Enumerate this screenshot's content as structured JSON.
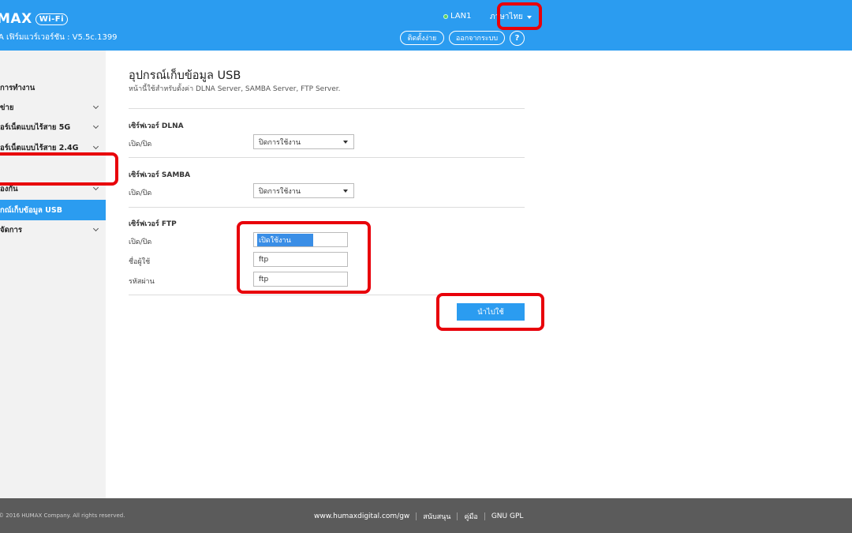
{
  "header": {
    "logo_text": "MAX",
    "logo_badge": "Wi-Fi",
    "firmware": "A เฟิร์มแวร์เวอร์ชัน : V5.5c.1399",
    "lan_label": "LAN1",
    "language": "ภาษาไทย",
    "setup_button": "ติดตั้งง่าย",
    "logout_button": "ออกจากระบบ",
    "help_label": "?"
  },
  "sidebar": {
    "items": [
      {
        "label": "การทำงาน",
        "chevron": false,
        "active": false
      },
      {
        "label": "ข่าย",
        "chevron": true,
        "active": false
      },
      {
        "label": "อร์เน็ตแบบไร้สาย 5G",
        "chevron": true,
        "active": false
      },
      {
        "label": "อร์เน็ตแบบไร้สาย 2.4G",
        "chevron": true,
        "active": false
      },
      {
        "label": "",
        "chevron": false,
        "active": false
      },
      {
        "label": "องกัน",
        "chevron": true,
        "active": false
      },
      {
        "label": "กณ์เก็บข้อมูล USB",
        "chevron": false,
        "active": true
      },
      {
        "label": "จัดการ",
        "chevron": true,
        "active": false
      }
    ]
  },
  "main": {
    "title": "อุปกรณ์เก็บข้อมูล USB",
    "description": "หน้านี้ใช้สำหรับตั้งค่า DLNA Server, SAMBA Server, FTP Server.",
    "dlna": {
      "title": "เซิร์ฟเวอร์ DLNA",
      "onoff_label": "เปิด/ปิด",
      "onoff_value": "ปิดการใช้งาน"
    },
    "samba": {
      "title": "เซิร์ฟเวอร์ SAMBA",
      "onoff_label": "เปิด/ปิด",
      "onoff_value": "ปิดการใช้งาน"
    },
    "ftp": {
      "title": "เซิร์ฟเวอร์ FTP",
      "onoff_label": "เปิด/ปิด",
      "onoff_value": "เปิดใช้งาน",
      "username_label": "ชื่อผู้ใช้",
      "username_value": "ftp",
      "password_label": "รหัสผ่าน",
      "password_value": "ftp"
    },
    "apply_button": "นำไปใช้"
  },
  "footer": {
    "copyright": "© 2016 HUMAX Company. All rights reserved.",
    "links": [
      "www.humaxdigital.com/gw",
      "สนับสนุน",
      "คู่มือ",
      "GNU GPL"
    ]
  },
  "colors": {
    "accent": "#2b9cf0",
    "annotation": "#e8000a",
    "footer": "#5b5b5b"
  }
}
